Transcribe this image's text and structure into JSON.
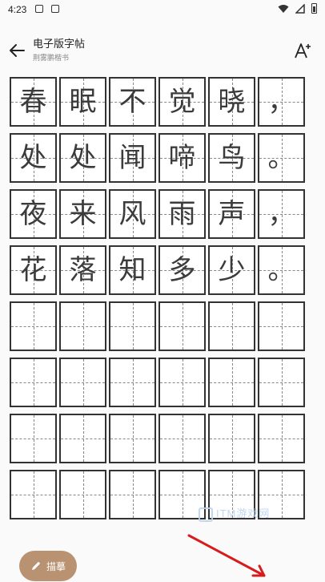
{
  "status_bar": {
    "time": "4:23"
  },
  "header": {
    "title": "电子版字帖",
    "subtitle": "荆雾鹏楷书"
  },
  "grid": {
    "rows": [
      [
        "春",
        "眠",
        "不",
        "觉",
        "晓",
        "，"
      ],
      [
        "处",
        "处",
        "闻",
        "啼",
        "鸟",
        "。"
      ],
      [
        "夜",
        "来",
        "风",
        "雨",
        "声",
        "，"
      ],
      [
        "花",
        "落",
        "知",
        "多",
        "少",
        "。"
      ],
      [
        "",
        "",
        "",
        "",
        "",
        ""
      ],
      [
        "",
        "",
        "",
        "",
        "",
        ""
      ],
      [
        "",
        "",
        "",
        "",
        "",
        ""
      ],
      [
        "",
        "",
        "",
        "",
        "",
        ""
      ]
    ]
  },
  "trace_button": {
    "label": "描摹",
    "color": "#b99272"
  },
  "watermark": {
    "text": "ITM游戏网"
  },
  "icons": {
    "back": "arrow-left-icon",
    "font_size": "font-size-increase-icon",
    "trace": "pencil-icon"
  }
}
